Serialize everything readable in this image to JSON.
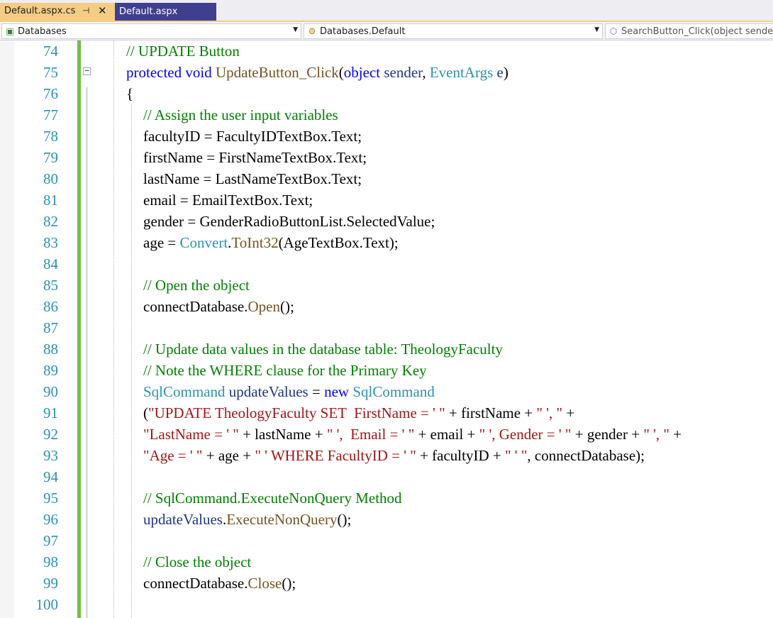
{
  "tabs": [
    {
      "label": "Default.aspx.cs",
      "active": true
    },
    {
      "label": "Default.aspx",
      "active": false
    }
  ],
  "navbar": {
    "project": "Databases",
    "type": "Databases.Default",
    "member": "SearchButton_Click(object sende"
  },
  "colors": {
    "comment": "#008000",
    "keyword": "#0000ff",
    "type": "#2b91af",
    "method": "#74531f",
    "string": "#a31515",
    "local": "#1f377f",
    "line_number": "#2b91af",
    "active_tab": "#f5cc84",
    "inactive_tab": "#3f3f8f",
    "change_bar": "#6cc04a"
  },
  "lines": [
    {
      "num": "74",
      "indent": 0,
      "parts": [
        [
          "c",
          "// UPDATE Button"
        ]
      ]
    },
    {
      "num": "75",
      "indent": 0,
      "parts": [
        [
          "k",
          "protected void "
        ],
        [
          "m",
          "UpdateButton_Click"
        ],
        [
          "",
          "("
        ],
        [
          "k",
          "object "
        ],
        [
          "v",
          "sender"
        ],
        [
          "",
          ", "
        ],
        [
          "t",
          "EventArgs "
        ],
        [
          "v",
          "e"
        ],
        [
          "",
          ")"
        ]
      ]
    },
    {
      "num": "76",
      "indent": 0,
      "parts": [
        [
          "",
          "{"
        ]
      ]
    },
    {
      "num": "77",
      "indent": 1,
      "parts": [
        [
          "c",
          "// Assign the user input variables"
        ]
      ]
    },
    {
      "num": "78",
      "indent": 1,
      "parts": [
        [
          "",
          "facultyID = FacultyIDTextBox.Text;"
        ]
      ]
    },
    {
      "num": "79",
      "indent": 1,
      "parts": [
        [
          "",
          "firstName = FirstNameTextBox.Text;"
        ]
      ]
    },
    {
      "num": "80",
      "indent": 1,
      "parts": [
        [
          "",
          "lastName = LastNameTextBox.Text;"
        ]
      ]
    },
    {
      "num": "81",
      "indent": 1,
      "parts": [
        [
          "",
          "email = EmailTextBox.Text;"
        ]
      ]
    },
    {
      "num": "82",
      "indent": 1,
      "parts": [
        [
          "",
          "gender = GenderRadioButtonList.SelectedValue;"
        ]
      ]
    },
    {
      "num": "83",
      "indent": 1,
      "parts": [
        [
          "",
          "age = "
        ],
        [
          "t",
          "Convert"
        ],
        [
          "",
          "."
        ],
        [
          "m",
          "ToInt32"
        ],
        [
          "",
          "(AgeTextBox.Text);"
        ]
      ]
    },
    {
      "num": "84",
      "indent": 1,
      "parts": []
    },
    {
      "num": "85",
      "indent": 1,
      "parts": [
        [
          "c",
          "// Open the object"
        ]
      ]
    },
    {
      "num": "86",
      "indent": 1,
      "parts": [
        [
          "",
          "connectDatabase."
        ],
        [
          "m",
          "Open"
        ],
        [
          "",
          "();"
        ]
      ]
    },
    {
      "num": "87",
      "indent": 1,
      "parts": []
    },
    {
      "num": "88",
      "indent": 1,
      "parts": [
        [
          "c",
          "// Update data values in the database table: TheologyFaculty"
        ]
      ]
    },
    {
      "num": "89",
      "indent": 1,
      "parts": [
        [
          "c",
          "// Note the WHERE clause for the Primary Key"
        ]
      ]
    },
    {
      "num": "90",
      "indent": 1,
      "parts": [
        [
          "t",
          "SqlCommand "
        ],
        [
          "v",
          "updateValues"
        ],
        [
          "",
          " = "
        ],
        [
          "k",
          "new "
        ],
        [
          "t",
          "SqlCommand"
        ]
      ]
    },
    {
      "num": "91",
      "indent": 1,
      "parts": [
        [
          "",
          "("
        ],
        [
          "s",
          "\"UPDATE TheologyFaculty SET  FirstName = ' \""
        ],
        [
          "",
          " + firstName + "
        ],
        [
          "s",
          "\" ', \""
        ],
        [
          "",
          " +"
        ]
      ]
    },
    {
      "num": "92",
      "indent": 1,
      "parts": [
        [
          "s",
          "\"LastName = ' \""
        ],
        [
          "",
          " + lastName + "
        ],
        [
          "s",
          "\" ',  Email = ' \""
        ],
        [
          "",
          " + email + "
        ],
        [
          "s",
          "\" ', Gender = ' \""
        ],
        [
          "",
          " + gender + "
        ],
        [
          "s",
          "\" ', \""
        ],
        [
          "",
          " +"
        ]
      ]
    },
    {
      "num": "93",
      "indent": 1,
      "parts": [
        [
          "s",
          "\"Age = ' \""
        ],
        [
          "",
          " + age + "
        ],
        [
          "s",
          "\" ' WHERE FacultyID = ' \""
        ],
        [
          "",
          " + facultyID + "
        ],
        [
          "s",
          "\" ' \""
        ],
        [
          "",
          ", connectDatabase);"
        ]
      ]
    },
    {
      "num": "94",
      "indent": 1,
      "parts": []
    },
    {
      "num": "95",
      "indent": 1,
      "parts": [
        [
          "c",
          "// SqlCommand.ExecuteNonQuery Method"
        ]
      ]
    },
    {
      "num": "96",
      "indent": 1,
      "parts": [
        [
          "v",
          "updateValues"
        ],
        [
          "",
          "."
        ],
        [
          "m",
          "ExecuteNonQuery"
        ],
        [
          "",
          "();"
        ]
      ]
    },
    {
      "num": "97",
      "indent": 1,
      "parts": []
    },
    {
      "num": "98",
      "indent": 1,
      "parts": [
        [
          "c",
          "// Close the object"
        ]
      ]
    },
    {
      "num": "99",
      "indent": 1,
      "parts": [
        [
          "",
          "connectDatabase."
        ],
        [
          "m",
          "Close"
        ],
        [
          "",
          "();"
        ]
      ]
    },
    {
      "num": "100",
      "indent": 1,
      "parts": []
    }
  ]
}
